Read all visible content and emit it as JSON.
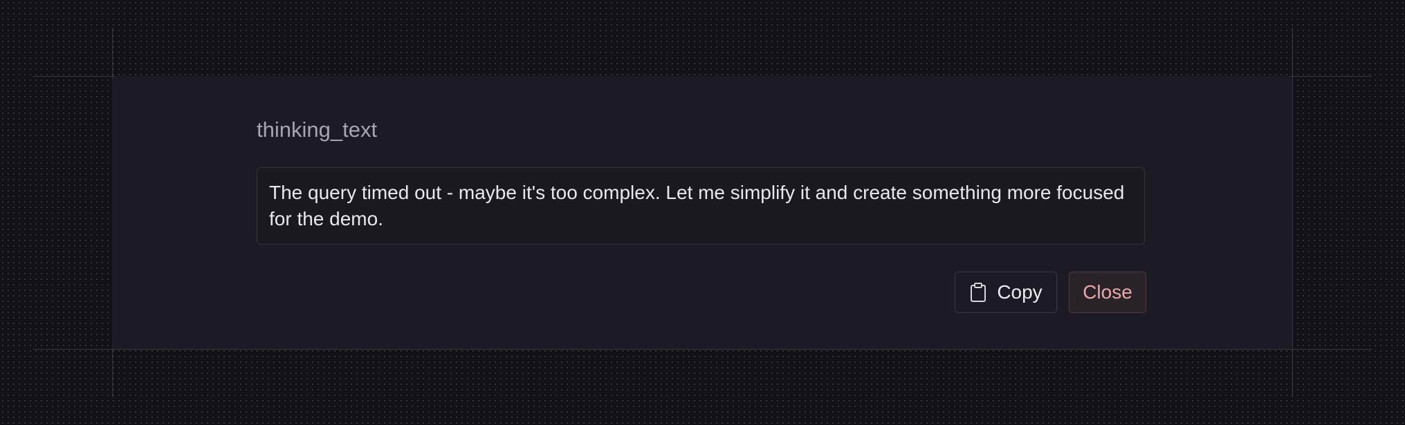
{
  "dialog": {
    "title": "thinking_text",
    "content": "The query timed out - maybe it's too complex. Let me simplify it and create something more focused for the demo.",
    "copy_label": "Copy",
    "copy_icon": "clipboard-icon",
    "close_label": "Close"
  },
  "colors": {
    "panel_background": "#1c1b24",
    "close_text": "#eba7a7",
    "title_text": "#a6a5b0"
  }
}
